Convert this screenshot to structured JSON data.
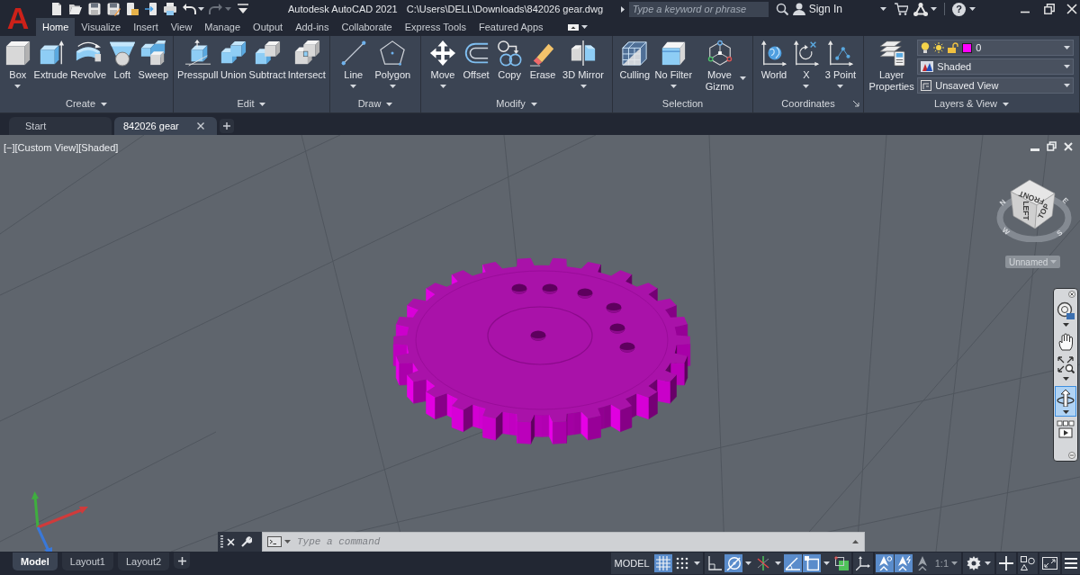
{
  "app": {
    "logo": "A",
    "title": "Autodesk AutoCAD 2021",
    "file_path": "C:\\Users\\DELL\\Downloads\\842026 gear.dwg"
  },
  "search": {
    "placeholder": "Type a keyword or phrase"
  },
  "account": {
    "label": "Sign In"
  },
  "help": {
    "glyph": "?"
  },
  "ribbon_tabs": [
    {
      "label": "Home",
      "selected": true
    },
    {
      "label": "Visualize",
      "selected": false
    },
    {
      "label": "Insert",
      "selected": false
    },
    {
      "label": "View",
      "selected": false
    },
    {
      "label": "Manage",
      "selected": false
    },
    {
      "label": "Output",
      "selected": false
    },
    {
      "label": "Add-ins",
      "selected": false
    },
    {
      "label": "Collaborate",
      "selected": false
    },
    {
      "label": "Express Tools",
      "selected": false
    },
    {
      "label": "Featured Apps",
      "selected": false
    }
  ],
  "ribbon_panels": [
    {
      "title": "Create",
      "menu": true,
      "launcher": false,
      "tools": [
        {
          "kind": "box",
          "label": "Box",
          "dropdown": true
        },
        {
          "kind": "extrude",
          "label": "Extrude",
          "dropdown": false
        },
        {
          "kind": "revolve",
          "label": "Revolve",
          "dropdown": false
        },
        {
          "kind": "loft",
          "label": "Loft",
          "dropdown": false
        },
        {
          "kind": "sweep",
          "label": "Sweep",
          "dropdown": false
        }
      ]
    },
    {
      "title": "Edit",
      "menu": true,
      "launcher": false,
      "tools": [
        {
          "kind": "presspull",
          "label": "Presspull",
          "dropdown": false
        },
        {
          "kind": "union",
          "label": "Union",
          "dropdown": false
        },
        {
          "kind": "subtract",
          "label": "Subtract",
          "dropdown": false
        },
        {
          "kind": "intersect",
          "label": "Intersect",
          "dropdown": false
        }
      ]
    },
    {
      "title": "Draw",
      "menu": true,
      "launcher": false,
      "tools": [
        {
          "kind": "line",
          "label": "Line",
          "dropdown": true
        },
        {
          "kind": "polygon",
          "label": "Polygon",
          "dropdown": true
        }
      ]
    },
    {
      "title": "Modify",
      "menu": true,
      "launcher": false,
      "tools": [
        {
          "kind": "move",
          "label": "Move",
          "dropdown": true
        },
        {
          "kind": "offset",
          "label": "Offset",
          "dropdown": false
        },
        {
          "kind": "copy",
          "label": "Copy",
          "dropdown": false
        },
        {
          "kind": "erase",
          "label": "Erase",
          "dropdown": false
        },
        {
          "kind": "mirror3d",
          "label": "3D Mirror",
          "dropdown": true
        }
      ]
    },
    {
      "title": "Selection",
      "menu": false,
      "launcher": false,
      "tools": [
        {
          "kind": "culling",
          "label": "Culling",
          "dropdown": false
        },
        {
          "kind": "nofilter",
          "label": "No Filter",
          "dropdown": true
        },
        {
          "kind": "movegizmo",
          "label": "Move Gizmo",
          "dropdown": true
        }
      ]
    },
    {
      "title": "Coordinates",
      "menu": false,
      "launcher": true,
      "tools": [
        {
          "kind": "ucsworld",
          "label": "World",
          "dropdown": false
        },
        {
          "kind": "ucsx",
          "label": "X",
          "dropdown": true
        },
        {
          "kind": "ucs3point",
          "label": "3 Point",
          "dropdown": true
        }
      ]
    },
    {
      "title": "Layers & View",
      "menu": true,
      "launcher": false,
      "tools": [
        {
          "kind": "layerproperties",
          "label": "Layer Properties",
          "dropdown": false
        }
      ],
      "dropdowns": [
        {
          "kind": "layer",
          "value": "0",
          "color": "#ff00ff"
        },
        {
          "kind": "visualstyle",
          "value": "Shaded"
        },
        {
          "kind": "view",
          "value": "Unsaved View"
        }
      ]
    }
  ],
  "document_tabs": [
    {
      "label": "Start",
      "selected": false
    },
    {
      "label": "842026 gear",
      "selected": true
    }
  ],
  "viewport": {
    "view_controls": [
      "[−]",
      "[Custom View]",
      "[Shaded]"
    ],
    "viewcube": {
      "top_face": "FRONT",
      "left_face": "LEFT",
      "right_face": "TOP",
      "compass": {
        "north": "N",
        "east": "E",
        "south": "S",
        "west": "W"
      },
      "view_name": "Unnamed"
    },
    "navigation_bar": {
      "tools": [
        {
          "kind": "wheel",
          "selected": false,
          "dropdown": true
        },
        {
          "kind": "pan",
          "selected": false,
          "dropdown": false
        },
        {
          "kind": "zoom",
          "selected": false,
          "dropdown": true
        },
        {
          "kind": "orbit",
          "selected": true,
          "dropdown": true
        },
        {
          "kind": "showmotion",
          "selected": false,
          "dropdown": false
        }
      ]
    }
  },
  "command_line": {
    "placeholder": "Type a command"
  },
  "layout_tabs": [
    {
      "label": "Model",
      "selected": true
    },
    {
      "label": "Layout1",
      "selected": false
    },
    {
      "label": "Layout2",
      "selected": false
    }
  ],
  "status_bar": {
    "space_label": "MODEL",
    "toggles": [
      {
        "kind": "grid",
        "on": true,
        "dropdown": false
      },
      {
        "kind": "snap",
        "on": false,
        "dropdown": true
      },
      {
        "kind": "ortho",
        "on": false,
        "dropdown": false
      },
      {
        "kind": "polar",
        "on": true,
        "dropdown": true
      },
      {
        "kind": "isodraft",
        "on": false,
        "dropdown": true
      },
      {
        "kind": "dynucs",
        "on": true,
        "dropdown": false
      },
      {
        "kind": "osnap",
        "on": true,
        "dropdown": true
      },
      {
        "kind": "transparency",
        "on": false,
        "dropdown": false
      },
      {
        "kind": "gizmo",
        "on": false,
        "dropdown": false
      },
      {
        "kind": "annovis",
        "on": true,
        "dropdown": false
      },
      {
        "kind": "autoscale",
        "on": true,
        "dropdown": false
      },
      {
        "kind": "annomonitor",
        "on": false,
        "dropdown": false
      }
    ],
    "annotation_scale": "1:1"
  }
}
